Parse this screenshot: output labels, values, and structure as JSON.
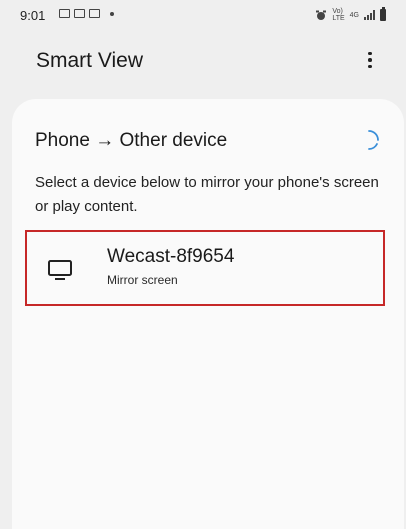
{
  "status_bar": {
    "time": "9:01",
    "left_icons": [
      "gallery-icon",
      "message-icon",
      "email-icon",
      "notification-dot-icon"
    ],
    "right_icons": [
      "alarm-icon",
      "volte-lte-icon",
      "4g-data-icon",
      "signal-icon",
      "battery-icon"
    ],
    "volte_label": "Vo)",
    "lte_label": "LTE",
    "net_label": "4G"
  },
  "app_bar": {
    "title": "Smart View",
    "more_icon": "more-vertical-icon"
  },
  "section": {
    "title": "Phone → Other device",
    "loading_icon": "spinner-icon",
    "description": "Select a device below to mirror your phone's screen or play content."
  },
  "devices": [
    {
      "name": "Wecast-8f9654",
      "subtitle": "Mirror screen",
      "icon": "tv-icon"
    }
  ],
  "colors": {
    "background": "#efefef",
    "card": "#fafafa",
    "highlight_border": "#c62828",
    "spinner": "#3a8fd9"
  }
}
